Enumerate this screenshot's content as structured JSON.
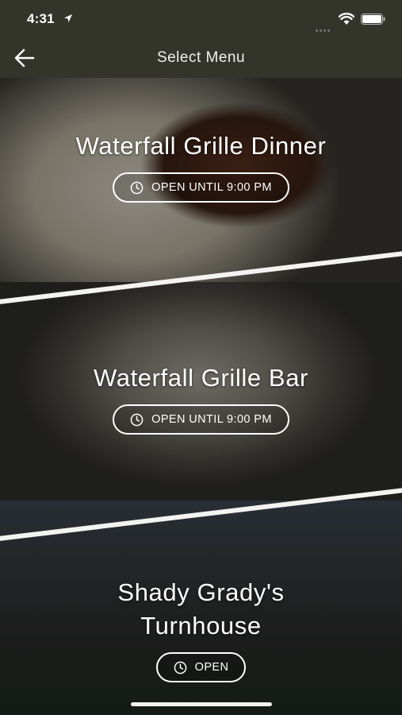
{
  "status_bar": {
    "time": "4:31"
  },
  "header": {
    "title": "Select Menu",
    "back_icon": "arrow-left-icon"
  },
  "menus": [
    {
      "name": "Waterfall Grille Dinner",
      "status": "OPEN UNTIL 9:00 PM",
      "icon": "clock-icon"
    },
    {
      "name": "Waterfall Grille Bar",
      "status": "OPEN UNTIL 9:00 PM",
      "icon": "clock-icon"
    },
    {
      "name_line1": "Shady Grady's",
      "name_line2": "Turnhouse",
      "status": "OPEN",
      "icon": "clock-icon"
    }
  ],
  "colors": {
    "header_bg": "#33342a",
    "text": "#ffffff",
    "separator": "#f3f3f0"
  }
}
